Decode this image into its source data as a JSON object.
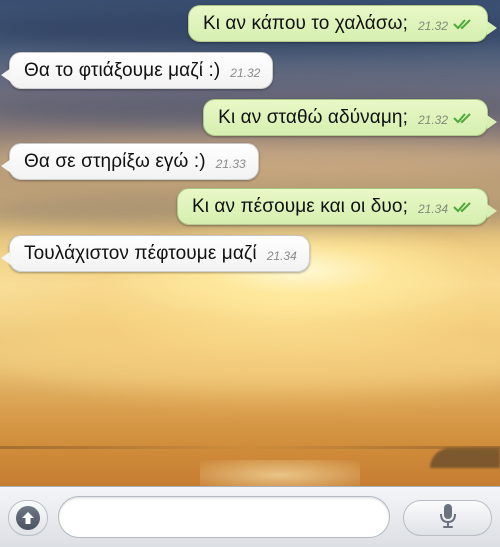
{
  "conversation": {
    "messages": [
      {
        "direction": "outgoing",
        "text": "Κι αν κάπου το χαλάσω;",
        "time": "21.32",
        "status": "read"
      },
      {
        "direction": "incoming",
        "text": "Θα το φτιάξουμε μαζί :)",
        "time": "21.32"
      },
      {
        "direction": "outgoing",
        "text": "Κι αν σταθώ αδύναμη;",
        "time": "21.32",
        "status": "read"
      },
      {
        "direction": "incoming",
        "text": "Θα σε στηρίξω εγώ :)",
        "time": "21.33"
      },
      {
        "direction": "outgoing",
        "text": "Κι αν πέσουμε και οι δυο;",
        "time": "21.34",
        "status": "read"
      },
      {
        "direction": "incoming",
        "text": "Τουλάχιστον πέφτουμε μαζί",
        "time": "21.34"
      }
    ]
  },
  "composer": {
    "attach_icon": "arrow-up-circle-icon",
    "input_value": "",
    "input_placeholder": "",
    "mic_icon": "microphone-icon"
  },
  "colors": {
    "outgoing_bubble": "#dcf3b8",
    "incoming_bubble": "#ffffff",
    "read_ticks": "#4fa83a"
  }
}
